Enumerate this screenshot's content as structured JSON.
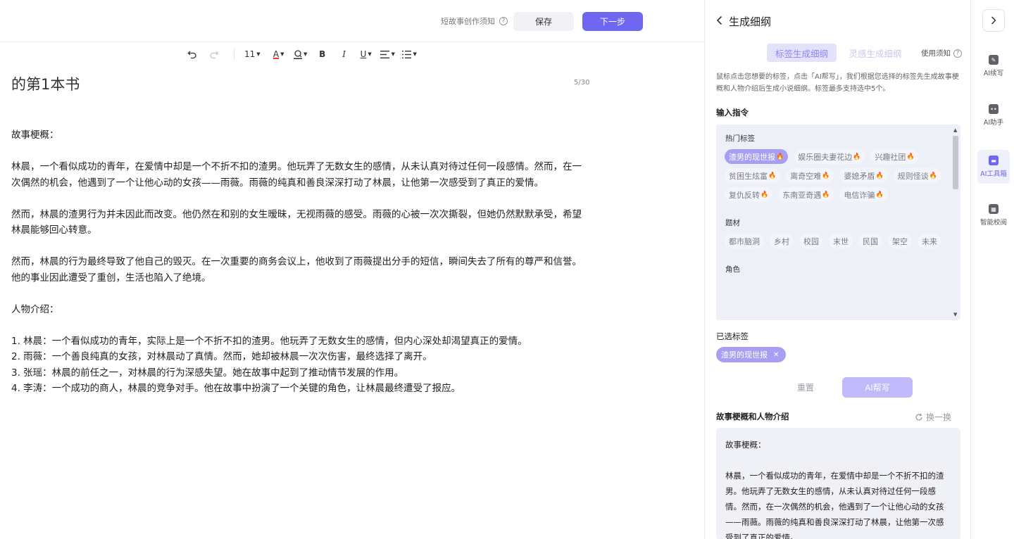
{
  "topbar": {
    "guide_label": "短故事创作须知",
    "guide_icon": "question-icon",
    "save_label": "保存",
    "next_label": "下一步"
  },
  "toolbar": {
    "undo_icon": "undo-icon",
    "redo_icon": "redo-icon",
    "font_size": "11",
    "font_color_glyph": "A",
    "bold_glyph": "B",
    "italic_glyph": "I",
    "underline_glyph": "U"
  },
  "editor": {
    "title": "的第1本书",
    "title_count": "5/30",
    "paragraphs": [
      "故事梗概：",
      "林晨，一个看似成功的青年，在爱情中却是一个不折不扣的渣男。他玩弄了无数女生的感情，从未认真对待过任何一段感情。然而，在一次偶然的机会，他遇到了一个让他心动的女孩——雨薇。雨薇的纯真和善良深深打动了林晨，让他第一次感受到了真正的爱情。",
      "然而，林晨的渣男行为并未因此而改变。他仍然在和别的女生暧昧，无视雨薇的感受。雨薇的心被一次次撕裂，但她仍然默默承受，希望林晨能够回心转意。",
      "然而，林晨的行为最终导致了他自己的毁灭。在一次重要的商务会议上，他收到了雨薇提出分手的短信，瞬间失去了所有的尊严和信誉。他的事业因此遭受了重创，生活也陷入了绝境。",
      "人物介绍："
    ],
    "characters": [
      "1. 林晨：一个看似成功的青年，实际上是一个不折不扣的渣男。他玩弄了无数女生的感情，但内心深处却渴望真正的爱情。",
      "2. 雨薇：一个善良纯真的女孩，对林晨动了真情。然而，她却被林晨一次次伤害，最终选择了离开。",
      "3. 张瑶：林晨的前任之一，对林晨的行为深感失望。她在故事中起到了推动情节发展的作用。",
      "4. 李涛：一个成功的商人，林晨的竞争对手。他在故事中扮演了一个关键的角色，让林晨最终遭受了报应。"
    ]
  },
  "panel": {
    "title": "生成细纲",
    "tab_tags": "标签生成细纲",
    "tab_inspiration": "灵感生成细纲",
    "usage_label": "使用须知",
    "description": "鼠标点击您想要的标签，点击「AI帮写」，我们根据您选择的标签先生成故事梗概和人物介绍后生成小说细纲。标签最多支持选中5个。",
    "input_label": "输入指令",
    "hot_tags_title": "热门标签",
    "hot_tags": [
      {
        "label": "渣男的现世报",
        "selected": true
      },
      {
        "label": "娱乐圈夫妻花边",
        "selected": false
      },
      {
        "label": "兴趣社团",
        "selected": false
      },
      {
        "label": "贫困生炫富",
        "selected": false
      },
      {
        "label": "离奇空难",
        "selected": false
      },
      {
        "label": "婆媳矛盾",
        "selected": false
      },
      {
        "label": "规则怪谈",
        "selected": false
      },
      {
        "label": "复仇反转",
        "selected": false
      },
      {
        "label": "东南亚奇遇",
        "selected": false
      },
      {
        "label": "电信诈骗",
        "selected": false
      }
    ],
    "theme_title": "题材",
    "themes": [
      "都市脑洞",
      "乡村",
      "校园",
      "末世",
      "民国",
      "架空",
      "未来"
    ],
    "role_title": "角色",
    "selected_label": "已选标签",
    "selected_tag": "渣男的现世报",
    "reset_label": "重置",
    "ai_write_label": "AI帮写",
    "story_section_label": "故事梗概和人物介绍",
    "swap_label": "换一换",
    "story_preview": [
      "故事梗概：",
      "林晨，一个看似成功的青年，在爱情中却是一个不折不扣的渣男。他玩弄了无数女生的感情，从未认真对待过任何一段感情。然而，在一次偶然的机会，他遇到了一个让他心动的女孩——雨薇。雨薇的纯真和善良深深打动了林晨，让他第一次感受到了真正的爱情。"
    ]
  },
  "rail": {
    "items": [
      {
        "label": "AI续写",
        "icon": "pen-icon",
        "active": false
      },
      {
        "label": "AI助手",
        "icon": "robot-icon",
        "active": false
      },
      {
        "label": "AI工具箱",
        "icon": "toolbox-icon",
        "active": true
      },
      {
        "label": "智能校阅",
        "icon": "proofread-icon",
        "active": false
      }
    ]
  },
  "colors": {
    "accent": "#6f67f2",
    "tag_selected": "#a99ff2",
    "tab_active_bg": "#e4e1fb"
  }
}
